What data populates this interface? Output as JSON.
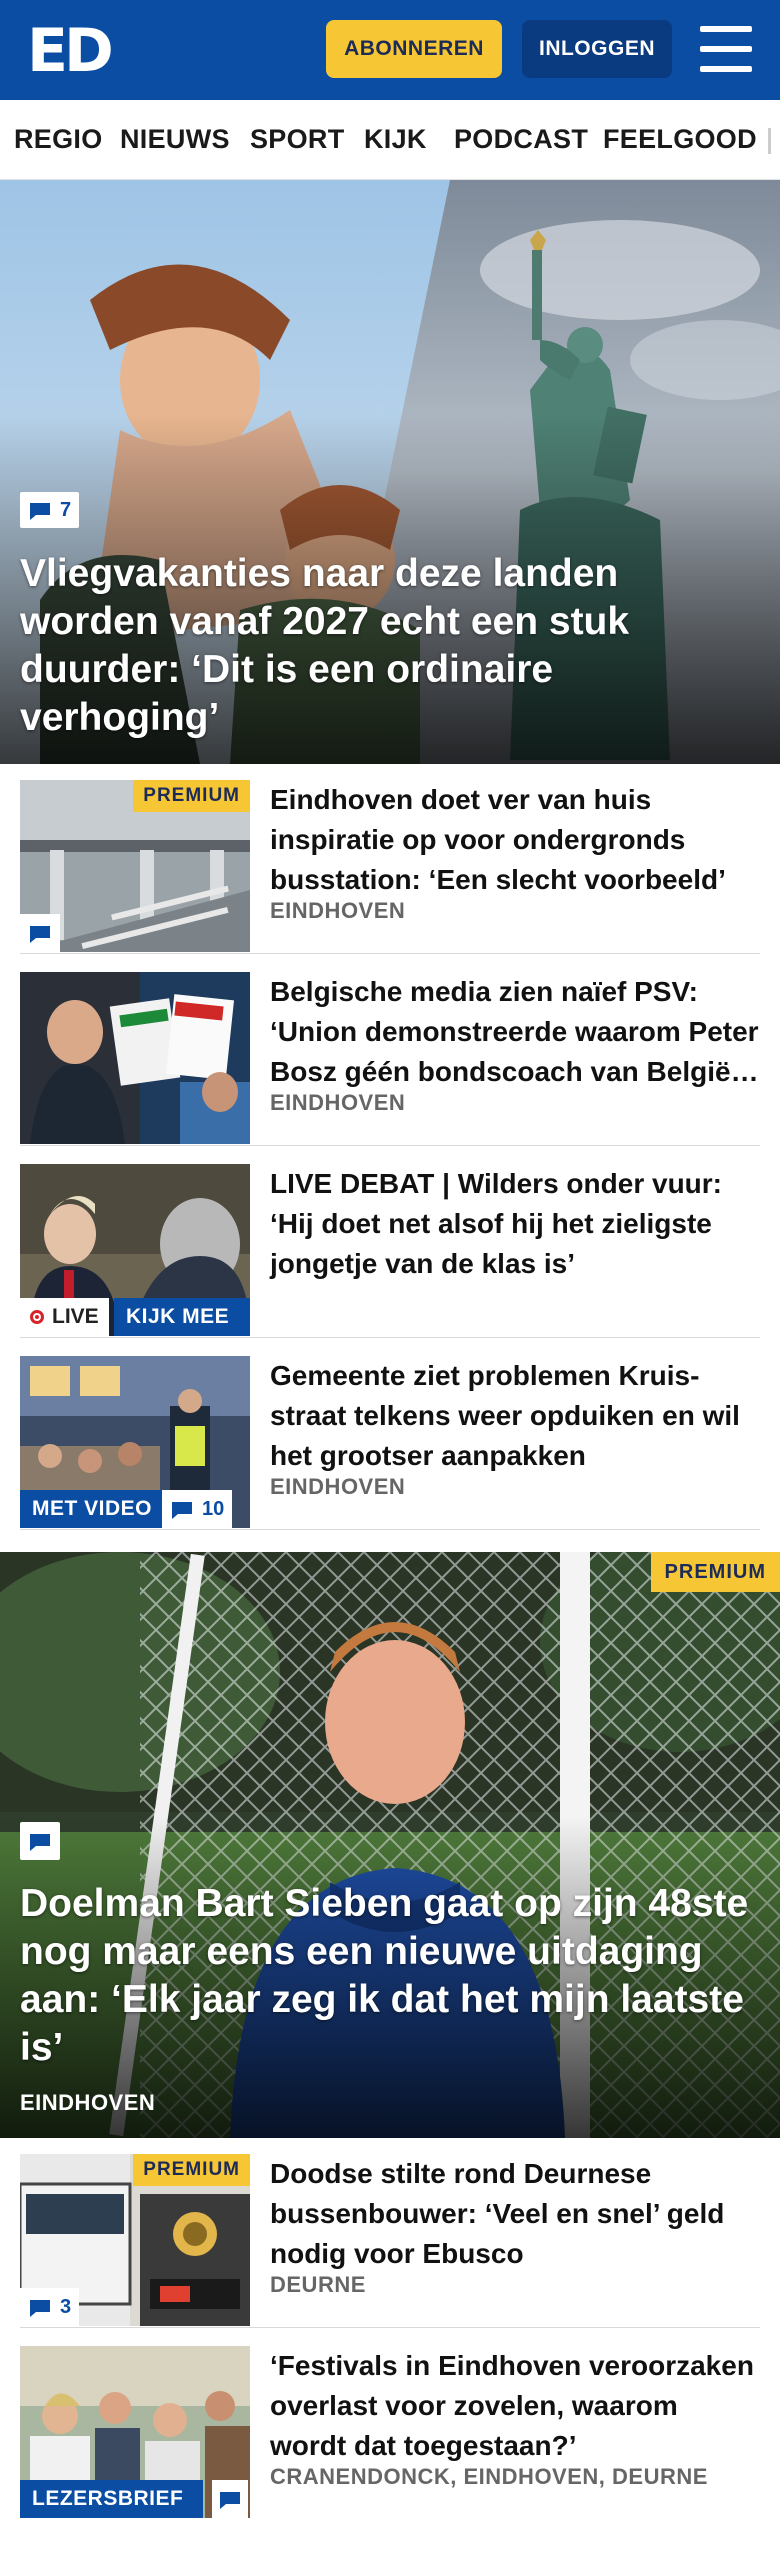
{
  "header": {
    "logo_text": "ED",
    "subscribe_label": "ABONNEREN",
    "login_label": "INLOGGEN",
    "menu_icon": "hamburger-menu-icon",
    "brand_color": "#0b4da2",
    "accent_color": "#f7c634"
  },
  "nav": {
    "items": [
      "REGIO",
      "NIEUWS",
      "SPORT",
      "KIJK",
      "PODCAST",
      "FEELGOOD"
    ]
  },
  "articles": {
    "hero1": {
      "comment_count": "7",
      "title": "Vliegvakanties naar deze landen worden vanaf 2027 echt een stuk duurder: ‘Dit is een ordinaire verhoging’"
    },
    "item1": {
      "badge": "PREMIUM",
      "title": "Eindhoven doet ver van huis inspiratie op voor ondergronds busstation: ‘Een slecht voorbeeld’",
      "category": "EINDHOVEN"
    },
    "item2": {
      "title": "Belgische media zien naïef PSV: ‘Union demonstreerde waarom Peter Bosz géén bondscoach van België wordt’",
      "category": "EINDHOVEN"
    },
    "item3": {
      "live_label": "LIVE",
      "watch_label": "KIJK MEE",
      "title": "LIVE DEBAT | Wilders onder vuur: ‘Hij doet net alsof hij het zieligste jongetje van de klas is’"
    },
    "item4": {
      "video_label": "MET VIDEO",
      "comment_count": "10",
      "title": "Gemeente ziet problemen Kruis­straat telkens weer opduiken en wil het grootser aanpakken",
      "category": "EINDHOVEN"
    },
    "hero2": {
      "badge": "PREMIUM",
      "title": "Doelman Bart Sieben gaat op zijn 48ste nog maar eens een nieuwe uitdaging aan: ‘Elk jaar zeg ik dat het mijn laatste is’",
      "category": "EINDHOVEN"
    },
    "item5": {
      "badge": "PREMIUM",
      "comment_count": "3",
      "title": "Doodse stilte rond Deurnese bussenbouwer: ‘Veel en snel’ geld nodig voor Ebusco",
      "category": "DEURNE"
    },
    "item6": {
      "label": "LEZERSBRIEF",
      "title": "‘Festivals in Eindhoven veroorza­ken overlast voor zovelen, waarom wordt dat toegestaan?’",
      "category": "CRANENDONCK, EINDHOVEN, DEURNE"
    }
  }
}
